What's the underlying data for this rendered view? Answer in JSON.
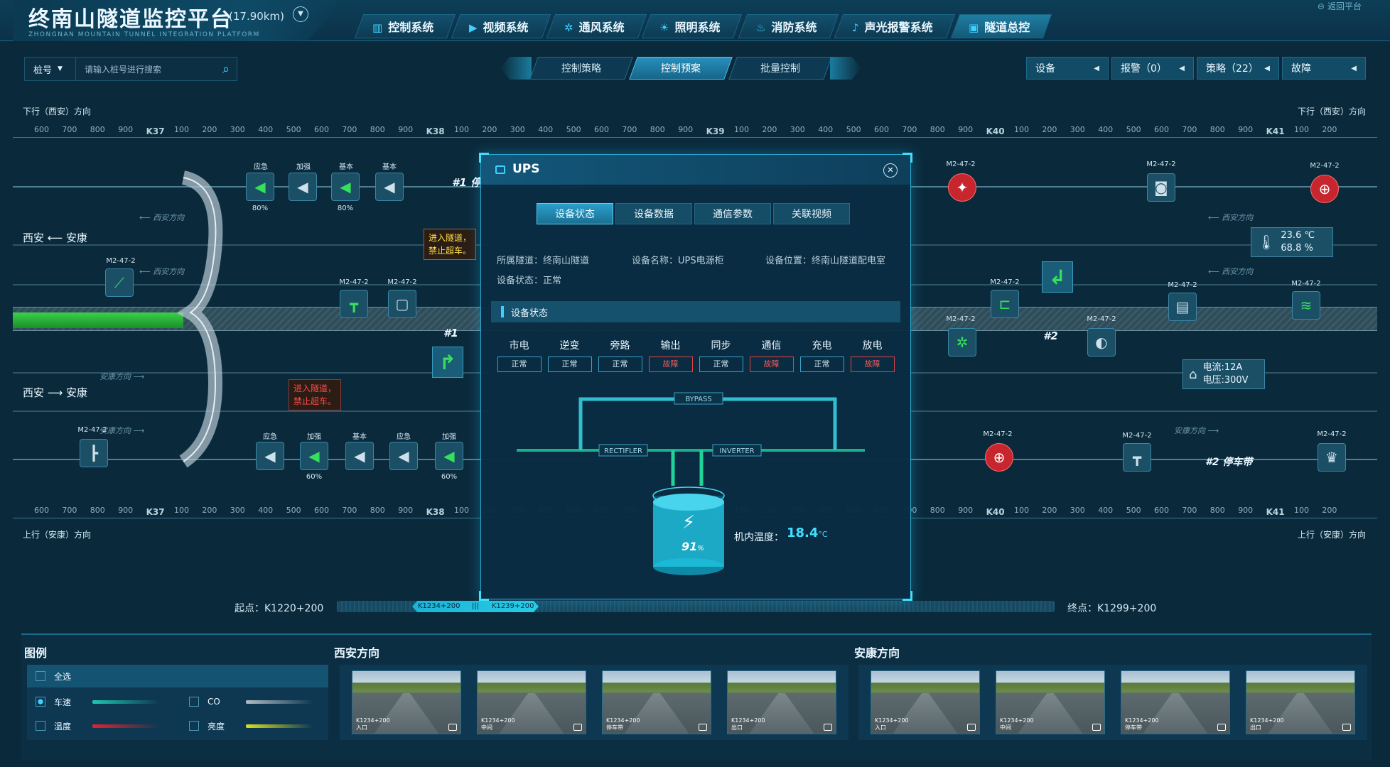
{
  "header": {
    "title": "终南山隧道监控平台",
    "length": "(17.90km)",
    "subtitle": "ZHONGNAN MOUNTAIN TUNNEL INTEGRATION PLATFORM",
    "back_label": "返回平台",
    "nav": [
      {
        "label": "控制系统",
        "icon": "control-icon"
      },
      {
        "label": "视频系统",
        "icon": "video-icon"
      },
      {
        "label": "通风系统",
        "icon": "fan-icon"
      },
      {
        "label": "照明系统",
        "icon": "light-icon"
      },
      {
        "label": "消防系统",
        "icon": "fire-icon"
      },
      {
        "label": "声光报警系统",
        "icon": "alarm-icon"
      },
      {
        "label": "隧道总控",
        "icon": "monitor-icon",
        "active": true
      }
    ]
  },
  "search": {
    "pile_label": "桩号",
    "placeholder": "请输入桩号进行搜索"
  },
  "control_tabs": [
    {
      "label": "控制策略"
    },
    {
      "label": "控制预案",
      "active": true
    },
    {
      "label": "批量控制"
    }
  ],
  "right_status": {
    "device": "设备",
    "alarm": "报警（0）",
    "strategy": "策略（22）",
    "fault": "故障"
  },
  "map": {
    "direction_down": "下行（西安）方向",
    "direction_up": "上行（安康）方向",
    "sign_upper": "西安 ⟵ 安康",
    "sign_lower": "西安 ⟶ 安康",
    "subdir_xian": "西安方向",
    "subdir_ankang": "安康方向",
    "ruler_ticks": [
      "600",
      "700",
      "800",
      "900",
      "K37",
      "100",
      "200",
      "300",
      "400",
      "500",
      "600",
      "700",
      "800",
      "900",
      "K38",
      "100",
      "200",
      "300",
      "400",
      "500",
      "600",
      "700",
      "800",
      "900",
      "K39",
      "100",
      "200",
      "300",
      "400",
      "500",
      "600",
      "700",
      "800",
      "900",
      "K40",
      "100",
      "200",
      "300",
      "400",
      "500",
      "600",
      "700",
      "800",
      "900",
      "K41",
      "100",
      "200"
    ],
    "device_code": "M2-47-2",
    "fan_labels_top": [
      "应急",
      "加强",
      "基本",
      "基本"
    ],
    "fan_pcts_top": [
      "80%",
      "",
      "80%",
      ""
    ],
    "fan_labels_bottom": [
      "应急",
      "加强",
      "基本",
      "应急",
      "加强"
    ],
    "fan_pcts_bottom": [
      "",
      "60%",
      "",
      "",
      "60%"
    ],
    "warn_yellow": [
      "进入隧道，",
      "禁止超车。"
    ],
    "warn_red": [
      "进入隧道，",
      "禁止超车。"
    ],
    "label_1": "#1",
    "label_2": "#2",
    "parking": "#2 停车带",
    "parking_1": "#1 停",
    "env": {
      "temp": "23.6 ℃",
      "humidity": "68.8 %"
    },
    "power": {
      "current": "电流:12A",
      "voltage": "电压:300V"
    }
  },
  "progress": {
    "start": "起点：K1220+200",
    "end": "终点：K1299+200",
    "marker_a": "K1234+200",
    "marker_b": "K1239+200",
    "sep": "|||"
  },
  "bottom": {
    "legend_title": "图例",
    "legend": [
      {
        "label": "全选",
        "checked": false
      },
      {
        "label": "车速",
        "checked": true,
        "color": "#1fc7b0"
      },
      {
        "label": "CO",
        "checked": false,
        "color": "#9aa7ad"
      },
      {
        "label": "温度",
        "checked": false,
        "color": "#e0242c"
      },
      {
        "label": "亮度",
        "checked": false,
        "color": "#d8e020"
      }
    ],
    "xian_title": "西安方向",
    "ankang_title": "安康方向",
    "xian_cams": [
      {
        "pos": "K1234+200",
        "name": "入口"
      },
      {
        "pos": "K1234+200",
        "name": "中间"
      },
      {
        "pos": "K1234+200",
        "name": "停车带"
      },
      {
        "pos": "K1234+200",
        "name": "出口"
      }
    ],
    "ankang_cams": [
      {
        "pos": "K1234+200",
        "name": "入口"
      },
      {
        "pos": "K1234+200",
        "name": "中间"
      },
      {
        "pos": "K1234+200",
        "name": "停车带"
      },
      {
        "pos": "K1234+200",
        "name": "出口"
      }
    ]
  },
  "modal": {
    "title": "UPS",
    "tabs": [
      {
        "label": "设备状态",
        "active": true
      },
      {
        "label": "设备数据"
      },
      {
        "label": "通信参数"
      },
      {
        "label": "关联视频"
      }
    ],
    "tunnel": "所属隧道：终南山隧道",
    "device_name": "设备名称：UPS电源柜",
    "location": "设备位置：终南山隧道配电室",
    "device_status": "设备状态：正常",
    "section_title": "设备状态",
    "statuses": [
      {
        "name": "市电",
        "value": "正常",
        "ok": true
      },
      {
        "name": "逆变",
        "value": "正常",
        "ok": true
      },
      {
        "name": "旁路",
        "value": "正常",
        "ok": true
      },
      {
        "name": "输出",
        "value": "故障",
        "ok": false
      },
      {
        "name": "同步",
        "value": "正常",
        "ok": true
      },
      {
        "name": "通信",
        "value": "故障",
        "ok": false
      },
      {
        "name": "充电",
        "value": "正常",
        "ok": true
      },
      {
        "name": "放电",
        "value": "故障",
        "ok": false
      }
    ],
    "diagram": {
      "bypass": "BYPASS",
      "rectifier": "RECTIFLER",
      "inverter": "INVERTER"
    },
    "battery": {
      "level": 91,
      "text": "91",
      "unit": "%"
    },
    "temp_label": "机内温度：",
    "temp_value": "18.4",
    "temp_unit": "°C"
  }
}
